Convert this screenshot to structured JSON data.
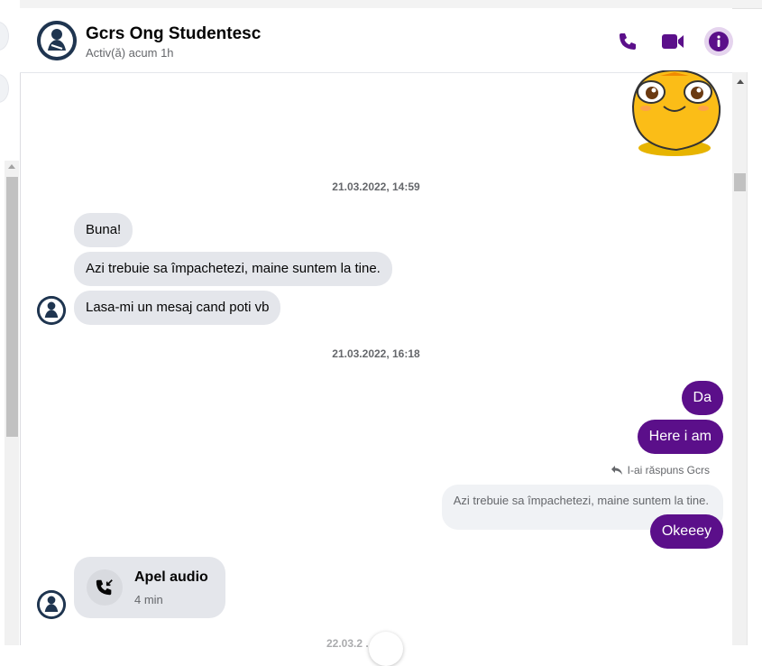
{
  "header": {
    "title": "Gcrs Ong Studentesc",
    "status": "Activ(ă) acum 1h",
    "icons": [
      "phone-icon",
      "video-camera-icon",
      "info-icon"
    ],
    "accent_color": "#5b0f8a"
  },
  "messages": {
    "timestamp_1": "21.03.2022, 14:59",
    "incoming_1": "Buna!",
    "incoming_2": "Azi trebuie sa împachetezi, maine suntem la tine.",
    "incoming_3": "Lasa-mi un mesaj cand poti vb",
    "timestamp_2": "21.03.2022, 16:18",
    "outgoing_1": "Da",
    "outgoing_2": "Here i am",
    "reply_note": "I-ai răspuns Gcrs",
    "quoted_text": "Azi trebuie sa împachetezi, maine suntem la tine.",
    "outgoing_3": "Okeeey",
    "call": {
      "title": "Apel audio",
      "duration": "4 min"
    },
    "timestamp_3_partial": "22.03.2 ... 7:59"
  },
  "colors": {
    "incoming_bubble": "#e4e6eb",
    "outgoing_bubble": "#5b0f8a",
    "secondary_text": "#65676b"
  }
}
